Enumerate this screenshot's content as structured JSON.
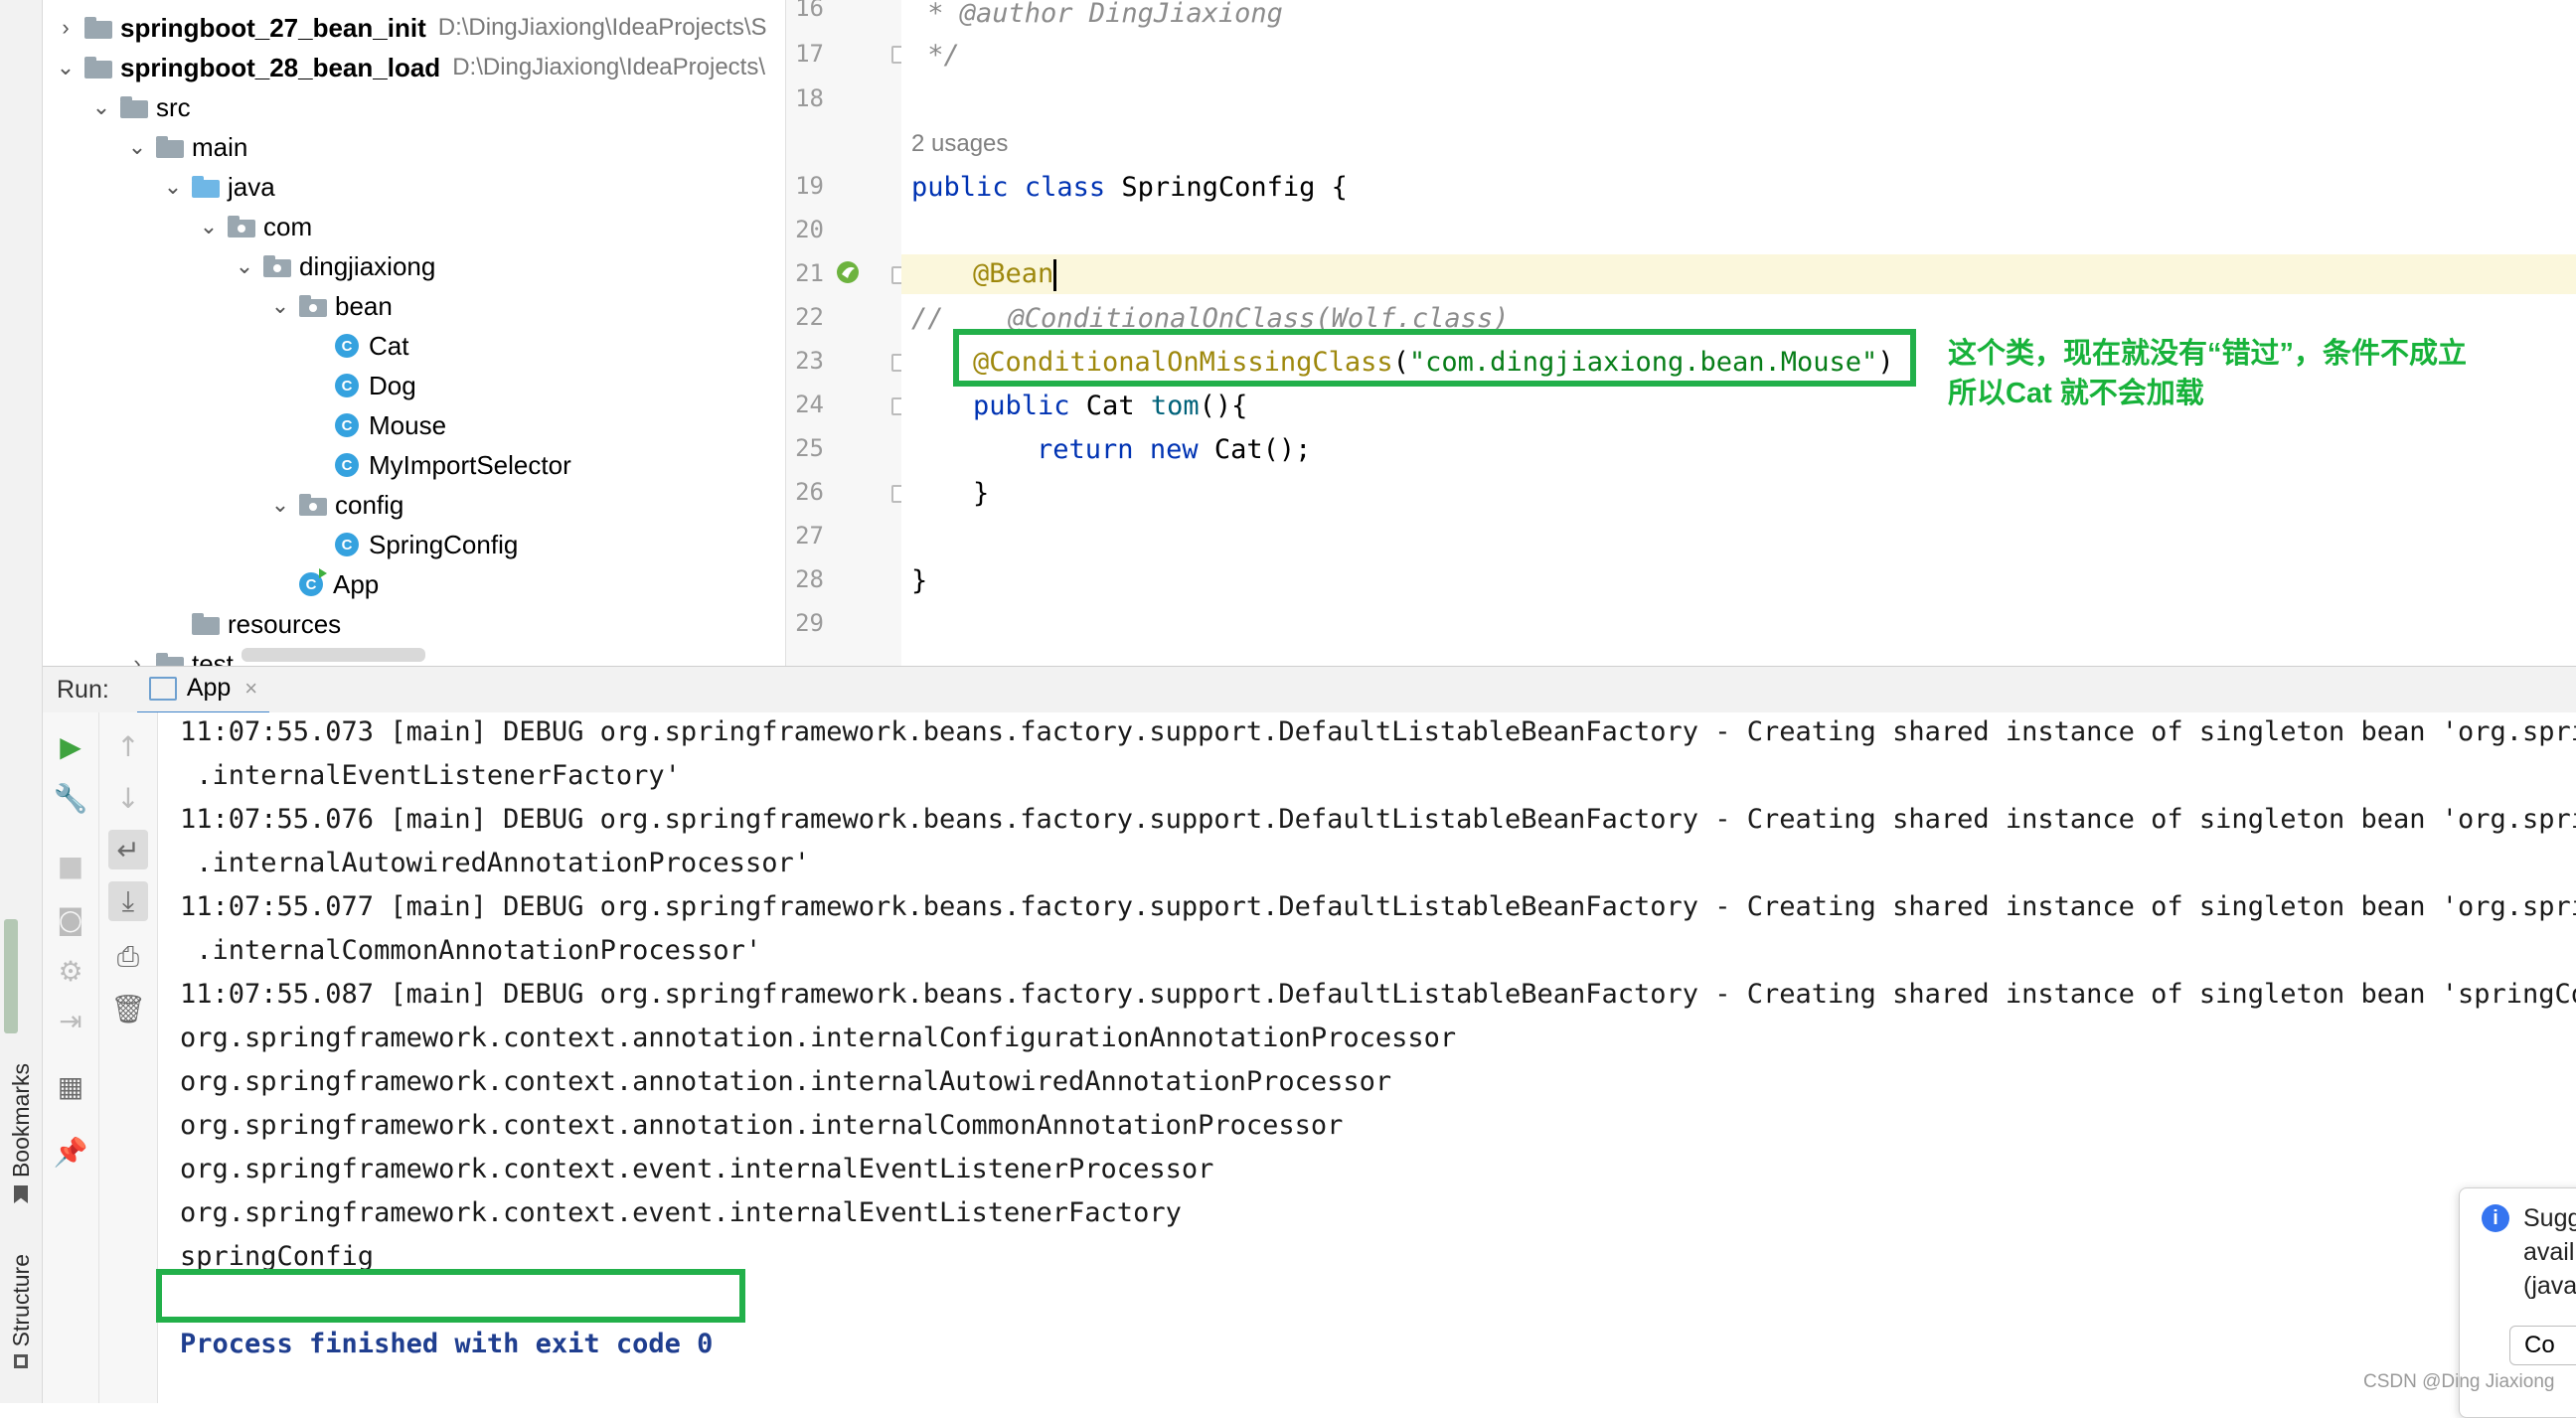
{
  "stripe": {
    "bookmarks_label": "Bookmarks",
    "structure_label": "Structure"
  },
  "tree": {
    "projects": [
      {
        "name": "springboot_27_bean_init",
        "path": "D:\\DingJiaxiong\\IdeaProjects\\S"
      },
      {
        "name": "springboot_28_bean_load",
        "path": "D:\\DingJiaxiong\\IdeaProjects\\"
      }
    ],
    "src": "src",
    "main": "main",
    "java": "java",
    "com": "com",
    "dingjiaxiong": "dingjiaxiong",
    "bean": "bean",
    "bean_classes": [
      "Cat",
      "Dog",
      "Mouse",
      "MyImportSelector"
    ],
    "config": "config",
    "config_classes": [
      "SpringConfig"
    ],
    "app": "App",
    "resources": "resources",
    "test": "test",
    "class_icon_letter": "C"
  },
  "editor": {
    "line_numbers": [
      "16",
      "17",
      "18",
      "19",
      "20",
      "21",
      "22",
      "23",
      "24",
      "25",
      "26",
      "27",
      "28",
      "29"
    ],
    "line16": " * @author DingJiaxiong",
    "line17": " */",
    "usages": "2 usages",
    "line19_kw1": "public",
    "line19_kw2": "class",
    "line19_rest": " SpringConfig {",
    "line21": "@Bean",
    "line22": "//    @ConditionalOnClass(Wolf.class)",
    "line23_ann": "@ConditionalOnMissingClass",
    "line23_open": "(",
    "line23_str": "\"com.dingjiaxiong.bean.Mouse\"",
    "line23_close": ")",
    "line24_kw": "public",
    "line24_type": " Cat ",
    "line24_fn": "tom",
    "line24_rest": "(){",
    "line25_kw1": "return",
    "line25_kw2": "new",
    "line25_rest": " Cat();",
    "line26": "}",
    "line28": "}"
  },
  "annotation": {
    "line1": "这个类，现在就没有“错过”，条件不成立",
    "line2": "所以Cat 就不会加载",
    "color": "#17b23a"
  },
  "run": {
    "label": "Run:",
    "tab": "App",
    "close": "×",
    "toolbar_icons": [
      "rerun-icon",
      "wrench-icon",
      "stop-icon",
      "camera-icon",
      "settings-icon",
      "login-icon",
      "layout-icon",
      "pin-icon"
    ],
    "toolbar2_icons": [
      "up-arrow-icon",
      "down-arrow-icon",
      "soft-wrap-icon",
      "scroll-to-end-icon",
      "print-icon",
      "trash-icon"
    ]
  },
  "console": {
    "lines": [
      "11:07:55.073 [main] DEBUG org.springframework.beans.factory.support.DefaultListableBeanFactory - Creating shared instance of singleton bean 'org.spring",
      " .internalEventListenerFactory'",
      "11:07:55.076 [main] DEBUG org.springframework.beans.factory.support.DefaultListableBeanFactory - Creating shared instance of singleton bean 'org.spring",
      " .internalAutowiredAnnotationProcessor'",
      "11:07:55.077 [main] DEBUG org.springframework.beans.factory.support.DefaultListableBeanFactory - Creating shared instance of singleton bean 'org.spring",
      " .internalCommonAnnotationProcessor'",
      "11:07:55.087 [main] DEBUG org.springframework.beans.factory.support.DefaultListableBeanFactory - Creating shared instance of singleton bean 'springConf",
      "org.springframework.context.annotation.internalConfigurationAnnotationProcessor",
      "org.springframework.context.annotation.internalAutowiredAnnotationProcessor",
      "org.springframework.context.annotation.internalCommonAnnotationProcessor",
      "org.springframework.context.event.internalEventListenerProcessor",
      "org.springframework.context.event.internalEventListenerFactory",
      "springConfig",
      "",
      "Process finished with exit code 0"
    ]
  },
  "notification": {
    "line1": "Sugg",
    "line2": "avail",
    "line3": "(java",
    "button": "Co"
  },
  "watermark": "CSDN @Ding Jiaxiong"
}
